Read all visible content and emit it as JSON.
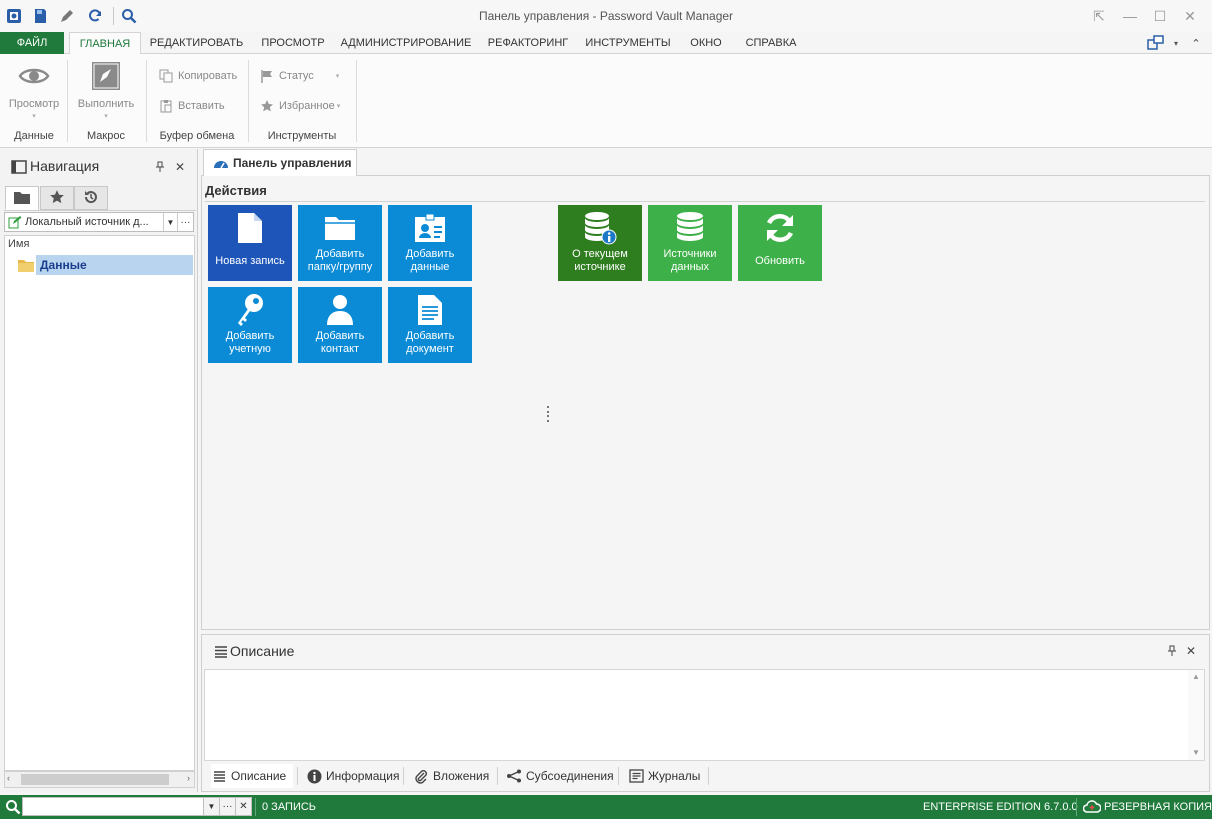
{
  "window": {
    "title": "Панель управления - Password Vault Manager",
    "controls": [
      "⇱",
      "—",
      "☐",
      "✕"
    ]
  },
  "menu": {
    "tabs": [
      "ФАЙЛ",
      "ГЛАВНАЯ",
      "РЕДАКТИРОВАТЬ",
      "ПРОСМОТР",
      "АДМИНИСТРИРОВАНИЕ",
      "РЕФАКТОРИНГ",
      "ИНСТРУМЕНТЫ",
      "ОКНО",
      "СПРАВКА"
    ],
    "active": "ГЛАВНАЯ"
  },
  "ribbon": {
    "view_label": "Просмотр",
    "execute_label": "Выполнить",
    "copy_label": "Копировать",
    "paste_label": "Вставить",
    "status_label": "Статус",
    "favorites_label": "Избранное",
    "groups": [
      "Данные",
      "Макрос",
      "Буфер обмена",
      "Инструменты"
    ]
  },
  "navigation": {
    "title": "Навигация",
    "datasource": "Локальный источник д...",
    "column_name": "Имя",
    "tree": [
      {
        "label": "Данные",
        "selected": true
      }
    ]
  },
  "dashboard": {
    "tab_label": "Панель управления",
    "section_title": "Действия",
    "tiles": [
      {
        "label": "Новая запись",
        "icon": "document-icon",
        "color": "#1e55b8"
      },
      {
        "label": "Добавить папку/группу",
        "icon": "folder-icon",
        "color": "#0b8bd6"
      },
      {
        "label": "Добавить данные",
        "icon": "id-card-icon",
        "color": "#0b8bd6"
      },
      {
        "label": "Добавить учетную",
        "icon": "key-icon",
        "color": "#0b8bd6"
      },
      {
        "label": "Добавить контакт",
        "icon": "person-icon",
        "color": "#0b8bd6"
      },
      {
        "label": "Добавить документ",
        "icon": "page-icon",
        "color": "#0b8bd6"
      },
      {
        "label": "О текущем источнике",
        "icon": "database-info-icon",
        "color": "#2e7d1e"
      },
      {
        "label": "Источники данных",
        "icon": "databases-icon",
        "color": "#3eb049"
      },
      {
        "label": "Обновить",
        "icon": "refresh-icon",
        "color": "#3eb049"
      }
    ]
  },
  "description": {
    "title": "Описание",
    "tabs": [
      "Описание",
      "Информация",
      "Вложения",
      "Субсоединения",
      "Журналы"
    ]
  },
  "statusbar": {
    "count": "0 ЗАПИСЬ",
    "edition": "ENTERPRISE EDITION 6.7.0.0",
    "backup": "РЕЗЕРВНАЯ КОПИЯ"
  },
  "colors": {
    "brand_green": "#1f7a3b",
    "tile_blue": "#0b8bd6",
    "tile_dark_blue": "#1e55b8",
    "tile_green": "#3eb049",
    "tile_dark_green": "#2e7d1e"
  }
}
